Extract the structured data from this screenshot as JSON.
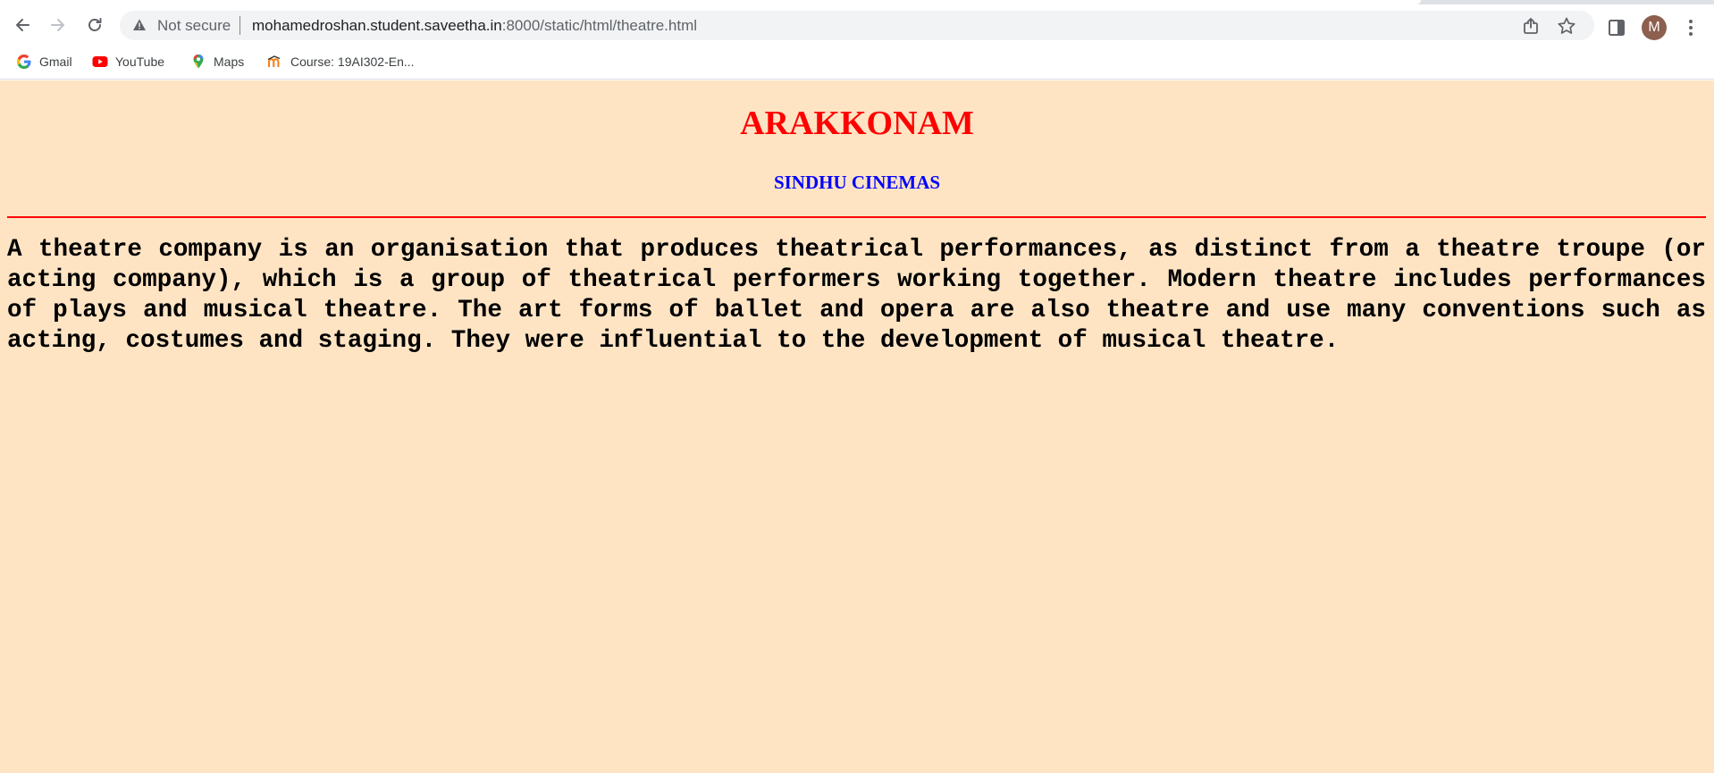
{
  "browser": {
    "security_label": "Not secure",
    "url_host": "mohamedroshan.student.saveetha.in",
    "url_path": ":8000/static/html/theatre.html",
    "avatar_initial": "M",
    "icons": {
      "back": "back-arrow-icon",
      "forward": "forward-arrow-icon",
      "reload": "reload-icon",
      "security": "warning-triangle-icon",
      "share": "share-icon",
      "bookmark": "star-icon",
      "side_panel": "side-panel-icon",
      "menu": "kebab-menu-icon"
    }
  },
  "bookmarks": [
    {
      "label": "Gmail",
      "icon": "google-icon"
    },
    {
      "label": "YouTube",
      "icon": "youtube-icon"
    },
    {
      "label": "Maps",
      "icon": "maps-pin-icon"
    },
    {
      "label": "Course: 19AI302-En...",
      "icon": "moodle-icon"
    }
  ],
  "page": {
    "title": "ARAKKONAM",
    "subtitle": "SINDHU CINEMAS",
    "paragraph": "A theatre company is an organisation that produces theatrical performances, as distinct from a theatre troupe (or acting company), which is a group of theatrical performers working together. Modern theatre includes performances of plays and musical theatre. The art forms of ballet and opera are also theatre and use many conventions such as acting, costumes and staging. They were influential to the development of musical theatre."
  },
  "colors": {
    "page_background": "#ffe4c4",
    "title": "#ff0000",
    "subtitle": "#0000ff",
    "rule": "#ff0000",
    "avatar": "#8d5f4f"
  }
}
